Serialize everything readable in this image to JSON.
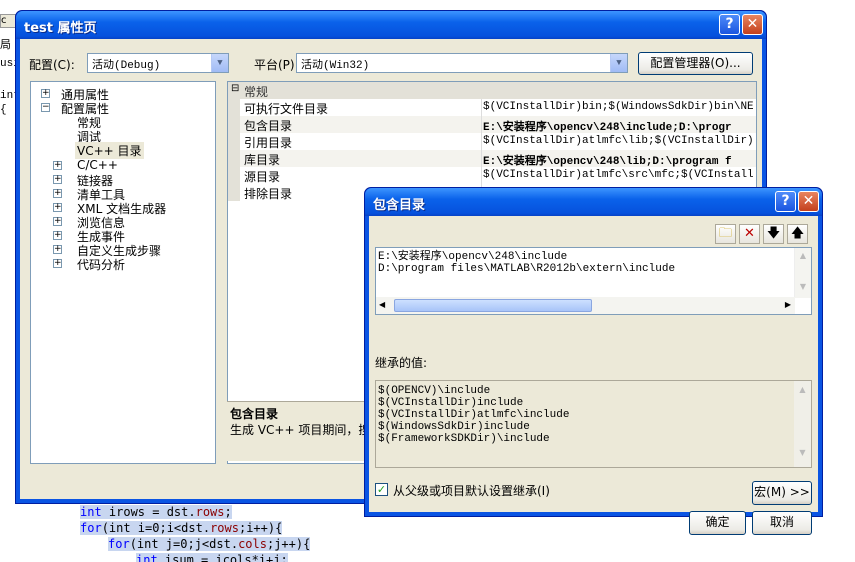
{
  "editor": {
    "tab_fragment": "c",
    "left_fragments": [
      "局",
      "usi",
      "int",
      "{"
    ],
    "lines": [
      {
        "kw": "int",
        "rest": " irows = dst.",
        "id": "rows",
        "tail": ";"
      },
      {
        "kw": "for",
        "rest": "(int i=0;i<dst.",
        "id": "rows",
        "tail": ";i++){"
      },
      {
        "kw": "for",
        "rest": "(int j=0;j<dst.",
        "id": "cols",
        "tail": ";j++){"
      },
      {
        "kw": "int",
        "rest": " isum = icols*i+j;",
        "id": "",
        "tail": ""
      }
    ]
  },
  "prop_dialog": {
    "title": "test 属性页",
    "config_label": "配置(C):",
    "config_value": "活动(Debug)",
    "platform_label": "平台(P):",
    "platform_value": "活动(Win32)",
    "config_manager_button": "配置管理器(O)...",
    "tree": [
      {
        "label": "通用属性",
        "expander": "+"
      },
      {
        "label": "配置属性",
        "expander": "-"
      },
      {
        "label": "常规",
        "expander": ""
      },
      {
        "label": "调试",
        "expander": ""
      },
      {
        "label": "VC++ 目录",
        "expander": ""
      },
      {
        "label": "C/C++",
        "expander": "+"
      },
      {
        "label": "链接器",
        "expander": "+"
      },
      {
        "label": "清单工具",
        "expander": "+"
      },
      {
        "label": "XML 文档生成器",
        "expander": "+"
      },
      {
        "label": "浏览信息",
        "expander": "+"
      },
      {
        "label": "生成事件",
        "expander": "+"
      },
      {
        "label": "自定义生成步骤",
        "expander": "+"
      },
      {
        "label": "代码分析",
        "expander": "+"
      }
    ],
    "grid_group": "常规",
    "grid_rows": [
      {
        "name": "可执行文件目录",
        "value": "$(VCInstallDir)bin;$(WindowsSdkDir)bin\\NETFX",
        "bold": false
      },
      {
        "name": "包含目录",
        "value": "E:\\安装程序\\opencv\\248\\include;D:\\progr",
        "bold": true
      },
      {
        "name": "引用目录",
        "value": "$(VCInstallDir)atlmfc\\lib;$(VCInstallDir)lib",
        "bold": false
      },
      {
        "name": "库目录",
        "value": "E:\\安装程序\\opencv\\248\\lib;D:\\program f",
        "bold": true
      },
      {
        "name": "源目录",
        "value": "$(VCInstallDir)atlmfc\\src\\mfc;$(VCInstallDir)",
        "bold": false
      },
      {
        "name": "排除目录",
        "value": "",
        "bold": false
      }
    ],
    "desc_title": "包含目录",
    "desc_text": "生成 VC++ 项目期间，搜"
  },
  "include_dialog": {
    "title": "包含目录",
    "toolbar": {
      "new_folder_icon": "new-folder-icon",
      "delete_icon": "delete-icon",
      "down_icon": "move-down-icon",
      "up_icon": "move-up-icon"
    },
    "entries": [
      "E:\\安装程序\\opencv\\248\\include",
      "D:\\program files\\MATLAB\\R2012b\\extern\\include"
    ],
    "inherited_label": "继承的值:",
    "inherited": [
      "$(OPENCV)\\include",
      "$(VCInstallDir)include",
      "$(VCInstallDir)atlmfc\\include",
      "$(WindowsSdkDir)include",
      "$(FrameworkSDKDir)\\include"
    ],
    "inherit_checkbox_label": "从父级或项目默认设置继承(I)",
    "inherit_checked": true,
    "macros_button": "宏(M) >>",
    "ok_button": "确定",
    "cancel_button": "取消"
  }
}
